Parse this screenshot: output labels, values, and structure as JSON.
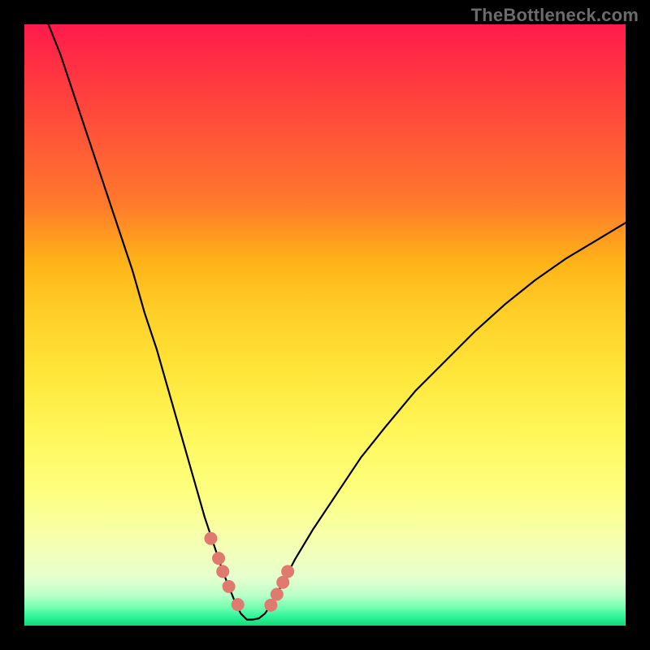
{
  "watermark": "TheBottleneck.com",
  "colors": {
    "curve": "#000000",
    "marker": "#e07a6f",
    "gradient_top": "#ff1a4c",
    "gradient_bottom": "#12d978",
    "frame": "#000000"
  },
  "chart_data": {
    "type": "line",
    "title": "",
    "xlabel": "",
    "ylabel": "",
    "x_range": [
      0,
      100
    ],
    "y_range": [
      0,
      100
    ],
    "description": "V-shaped bottleneck curve over a vertical rainbow gradient; minimum near x≈37, right arm shallower than left.",
    "series": [
      {
        "name": "bottleneck-curve",
        "x": [
          4,
          6,
          8,
          10,
          12,
          14,
          16,
          18,
          20,
          22,
          24,
          26,
          28,
          30,
          32,
          33,
          34,
          35,
          36,
          37,
          38,
          39,
          40,
          41,
          42,
          43,
          45,
          48,
          52,
          56,
          60,
          65,
          70,
          75,
          80,
          85,
          90,
          95,
          100
        ],
        "y": [
          100,
          95,
          89,
          83,
          77,
          71,
          65,
          59,
          52,
          46,
          39,
          32,
          25,
          18,
          12,
          9,
          6.5,
          4,
          2,
          1,
          1,
          1.2,
          2,
          3.4,
          5.2,
          7.2,
          11,
          16,
          22,
          28,
          33,
          39,
          44,
          49,
          53.5,
          57.5,
          61,
          64,
          67
        ]
      }
    ],
    "markers": {
      "name": "highlight-dots",
      "x": [
        31.0,
        32.3,
        33.0,
        34.0,
        35.5,
        41.0,
        42.0,
        43.0,
        43.8
      ],
      "y": [
        14.5,
        11.2,
        9.0,
        6.5,
        3.5,
        3.4,
        5.2,
        7.2,
        9.0
      ],
      "radius_px": 8
    }
  }
}
